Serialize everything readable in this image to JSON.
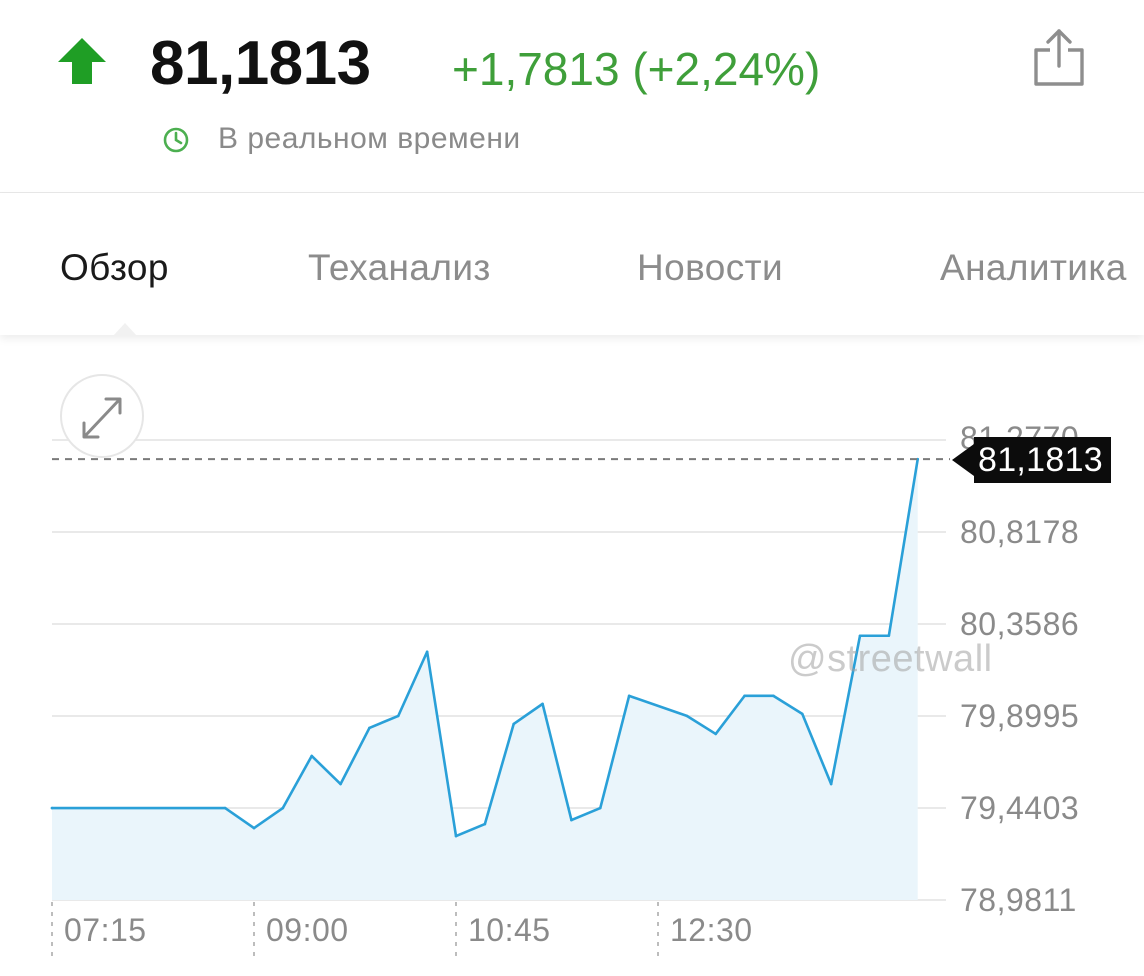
{
  "header": {
    "price": "81,1813",
    "change": "+1,7813 (+2,24%)",
    "realtime_label": "В реальном времени",
    "colors": {
      "up": "#1f9e25",
      "change": "#3f9f3a",
      "clock": "#4caf50"
    },
    "icons": {
      "direction": "up-arrow-icon",
      "realtime": "clock-icon",
      "share": "share-icon"
    }
  },
  "tabs": [
    {
      "label": "Обзор",
      "active": true
    },
    {
      "label": "Теханализ",
      "active": false
    },
    {
      "label": "Новости",
      "active": false
    },
    {
      "label": "Аналитика",
      "active": false
    }
  ],
  "chart": {
    "expand_icon": "expand-icon",
    "watermark": "@streetwall",
    "current_price_label": "81,1813"
  },
  "chart_data": {
    "type": "area",
    "series_color": "#2aa0d8",
    "fill_color": "#eaf5fb",
    "current_price": 81.1813,
    "y_ticks": [
      "81,2770",
      "80,8178",
      "80,3586",
      "79,8995",
      "79,4403",
      "78,9811"
    ],
    "y_tick_values": [
      81.277,
      80.8178,
      80.3586,
      79.8995,
      79.4403,
      78.9811
    ],
    "ylim": [
      78.9811,
      81.277
    ],
    "x_ticks": [
      "07:15",
      "09:00",
      "10:45",
      "12:30"
    ],
    "x_tick_values": [
      "07:15",
      "09:00",
      "10:45",
      "12:30"
    ],
    "xlim": [
      "07:15",
      "14:45"
    ],
    "grid": true,
    "points": [
      [
        "07:15",
        79.44
      ],
      [
        "08:45",
        79.44
      ],
      [
        "09:00",
        79.34
      ],
      [
        "09:15",
        79.44
      ],
      [
        "09:30",
        79.7
      ],
      [
        "09:45",
        79.56
      ],
      [
        "10:00",
        79.84
      ],
      [
        "10:15",
        79.9
      ],
      [
        "10:30",
        80.22
      ],
      [
        "10:45",
        79.3
      ],
      [
        "11:00",
        79.36
      ],
      [
        "11:15",
        79.86
      ],
      [
        "11:30",
        79.96
      ],
      [
        "11:45",
        79.38
      ],
      [
        "12:00",
        79.44
      ],
      [
        "12:15",
        80.0
      ],
      [
        "12:45",
        79.9
      ],
      [
        "13:00",
        79.81
      ],
      [
        "13:15",
        80.0
      ],
      [
        "13:30",
        80.0
      ],
      [
        "13:45",
        79.91
      ],
      [
        "14:00",
        79.56
      ],
      [
        "14:15",
        80.3
      ],
      [
        "14:30",
        80.3
      ],
      [
        "14:45",
        81.1813
      ]
    ]
  }
}
